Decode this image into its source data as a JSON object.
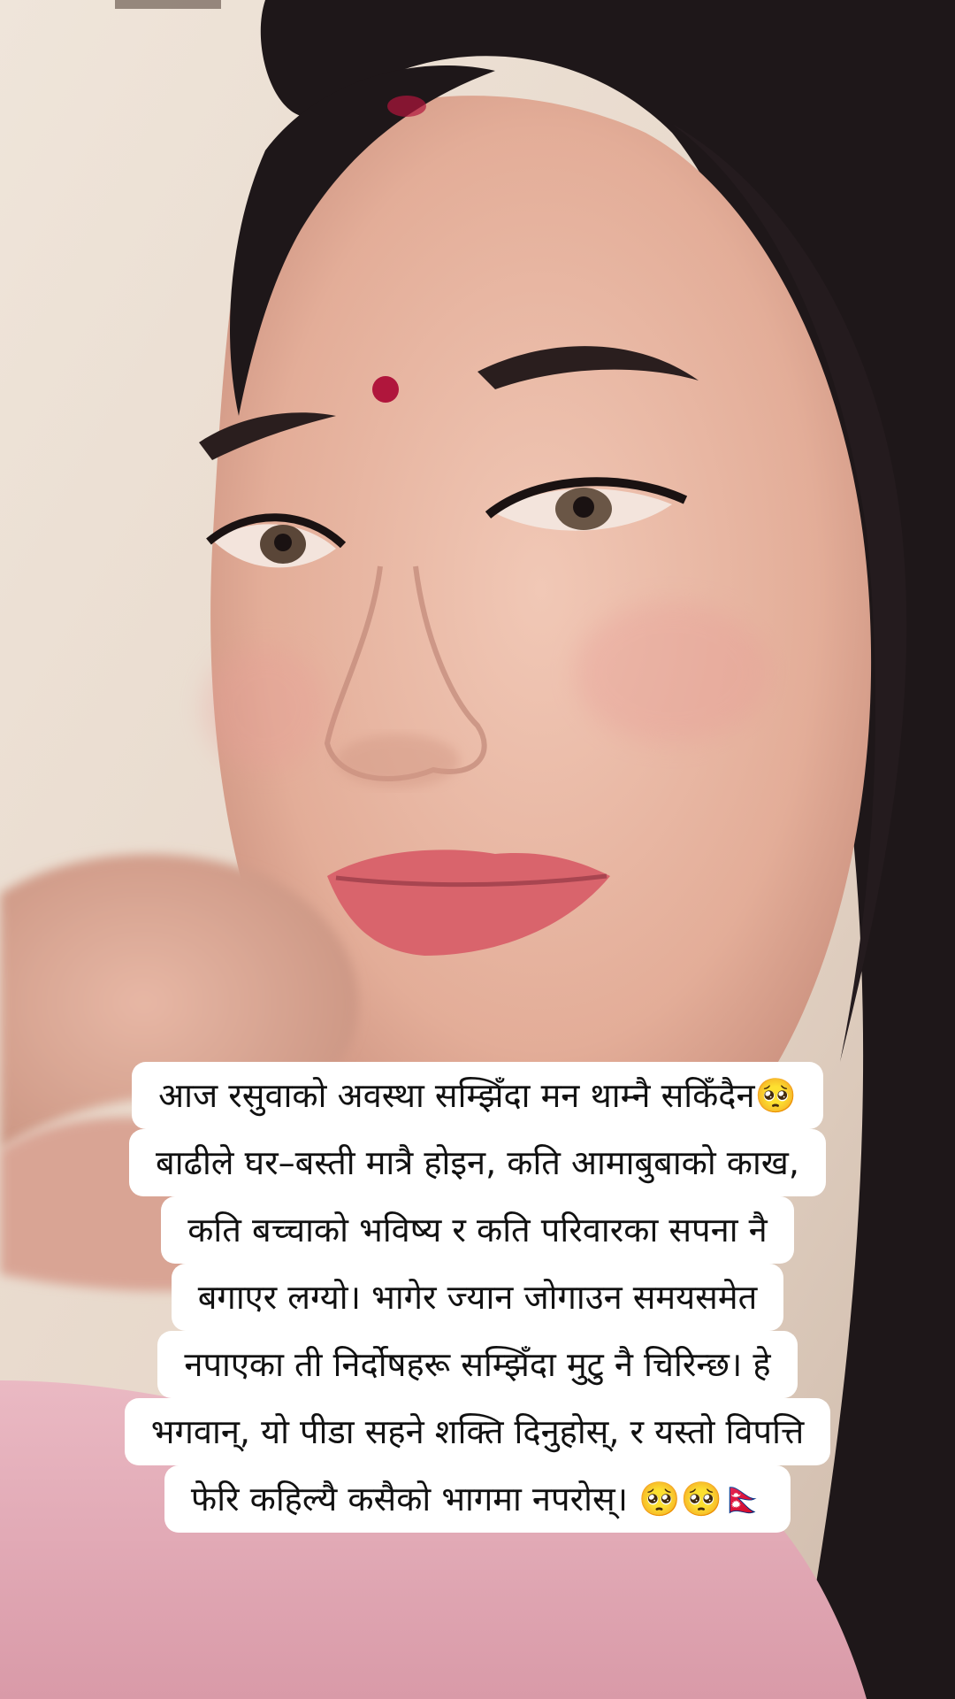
{
  "caption": {
    "lines": [
      "आज रसुवाको अवस्था सम्झिँदा मन थाम्नै सकिँदैन🥺",
      "बाढीले घर–बस्ती मात्रै होइन, कति आमाबुबाको काख,",
      "कति बच्चाको भविष्य र कति परिवारका सपना नै",
      "बगाएर लग्यो। भागेर ज्यान जोगाउन समयसमेत",
      "नपाएका ती निर्दोषहरू सम्झिँदा मुटु नै चिरिन्छ। हे",
      "भगवान्, यो पीडा सहने शक्ति दिनुहोस्, र यस्तो विपत्ति",
      "फेरि कहिल्यै कसैको भागमा नपरोस्। 🥺🥺🇳🇵"
    ]
  },
  "colors": {
    "caption_background": "#ffffff",
    "caption_text": "#111111",
    "wall": "#e9ddd2",
    "skin": "#e7b8a4",
    "hair": "#1c1618",
    "lips": "#d9646c",
    "bindi": "#b0163c",
    "shirt": "#e9b6bf"
  }
}
